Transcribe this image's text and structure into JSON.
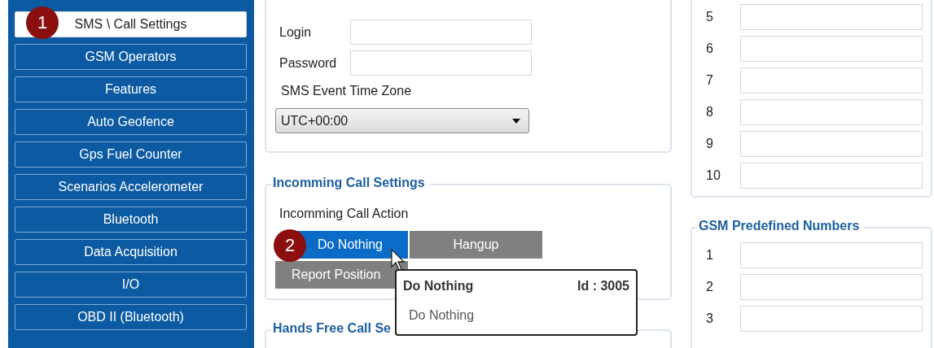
{
  "sidebar": {
    "items": [
      {
        "label": "SMS \\ Call Settings",
        "selected": true,
        "badge": "1"
      },
      {
        "label": "GSM Operators",
        "selected": false
      },
      {
        "label": "Features",
        "selected": false
      },
      {
        "label": "Auto Geofence",
        "selected": false
      },
      {
        "label": "Gps Fuel Counter",
        "selected": false
      },
      {
        "label": "Scenarios Accelerometer",
        "selected": false
      },
      {
        "label": "Bluetooth",
        "selected": false
      },
      {
        "label": "Data Acquisition",
        "selected": false
      },
      {
        "label": "I/O",
        "selected": false
      },
      {
        "label": "OBD II (Bluetooth)",
        "selected": false
      }
    ]
  },
  "sms_commands": {
    "fields": [
      {
        "label": "Login"
      },
      {
        "label": "Password"
      }
    ],
    "time_zone_label": "SMS Event Time Zone",
    "time_zone": "UTC+00:00"
  },
  "incoming_call": {
    "title": "Incomming Call Settings",
    "action_label": "Incomming Call Action",
    "badge": "2",
    "options": [
      {
        "label": "Do Nothing",
        "selected": true
      },
      {
        "label": "Hangup",
        "selected": false
      },
      {
        "label": "Report Position",
        "selected": false
      }
    ]
  },
  "tooltip": {
    "title": "Do Nothing",
    "id": "Id : 3005",
    "description": "Do Nothing"
  },
  "hands_free": {
    "title": "Hands Free Call Se"
  },
  "numbers_top": {
    "rows": [
      "5",
      "6",
      "7",
      "8",
      "9",
      "10"
    ]
  },
  "predefined": {
    "title": "GSM Predefined Numbers",
    "rows": [
      "1",
      "2",
      "3"
    ]
  }
}
